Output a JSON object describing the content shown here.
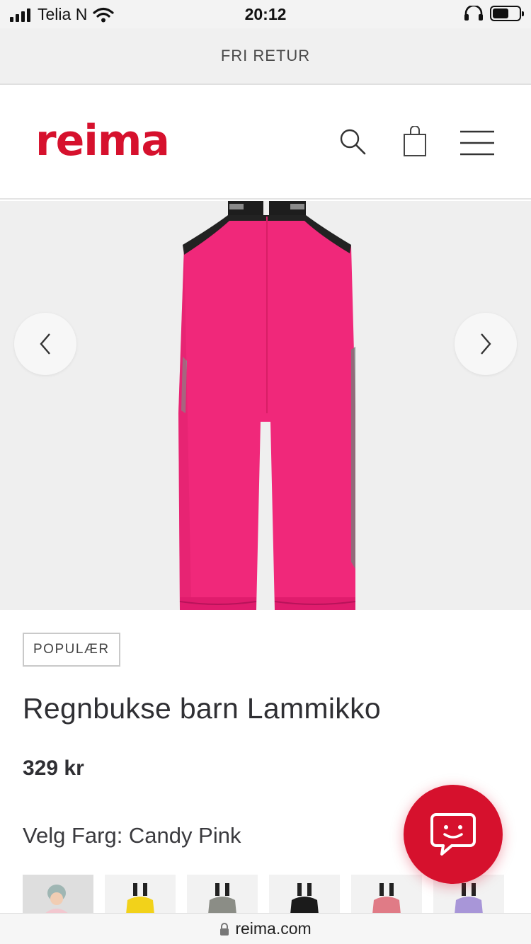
{
  "status_bar": {
    "carrier": "Telia N",
    "time": "20:12",
    "battery_level": 0.62
  },
  "promo": {
    "text": "FRI RETUR"
  },
  "header": {
    "logo": "reima",
    "icons": [
      "search-icon",
      "bag-icon",
      "menu-icon"
    ],
    "brand_color": "#d6112d"
  },
  "gallery": {
    "prev_icon": "chevron-left-icon",
    "next_icon": "chevron-right-icon",
    "product_color": "#f0287a"
  },
  "product": {
    "badge": "POPULÆR",
    "title": "Regnbukse barn Lammikko",
    "price": "329 kr",
    "color_line": "Velg Farg: Candy Pink"
  },
  "swatches": [
    {
      "name": "photo",
      "color": "#d9d9d9"
    },
    {
      "name": "yellow",
      "color": "#f2d21a"
    },
    {
      "name": "grey",
      "color": "#8b8d86"
    },
    {
      "name": "black",
      "color": "#1b1b1b"
    },
    {
      "name": "pink",
      "color": "#e07b86"
    },
    {
      "name": "lilac",
      "color": "#a896d8"
    }
  ],
  "chat": {
    "icon": "chat-smiley-icon"
  },
  "url_bar": {
    "url": "reima.com",
    "icon": "lock-icon"
  }
}
